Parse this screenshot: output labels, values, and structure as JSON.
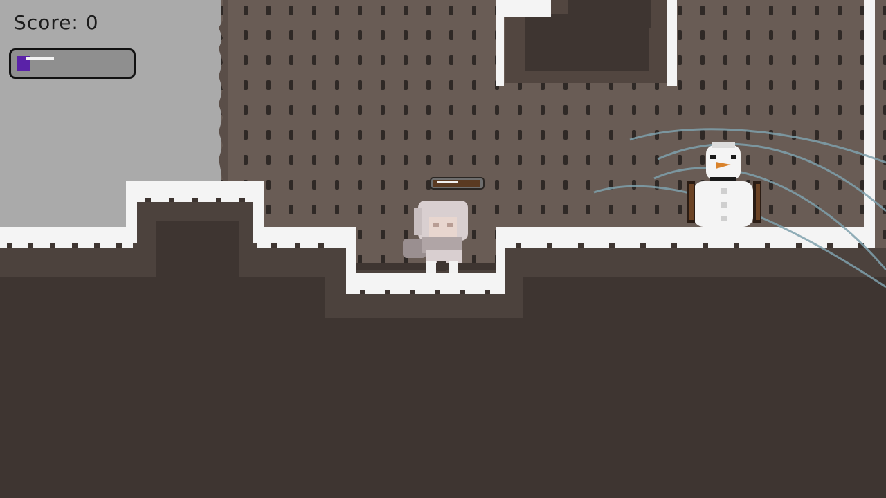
{
  "hud": {
    "score_label": "Score: 0",
    "energy_level": 0.12,
    "energy_color": "#5a22a8"
  },
  "player": {
    "health_level": 0.97,
    "health_color": "#5a3a22"
  },
  "colors": {
    "sky": "#aaaaaa",
    "cave_wall": "#695c55",
    "ground": "#3e3531",
    "snow": "#f4f4f4",
    "wind": "#7fa1ad"
  }
}
